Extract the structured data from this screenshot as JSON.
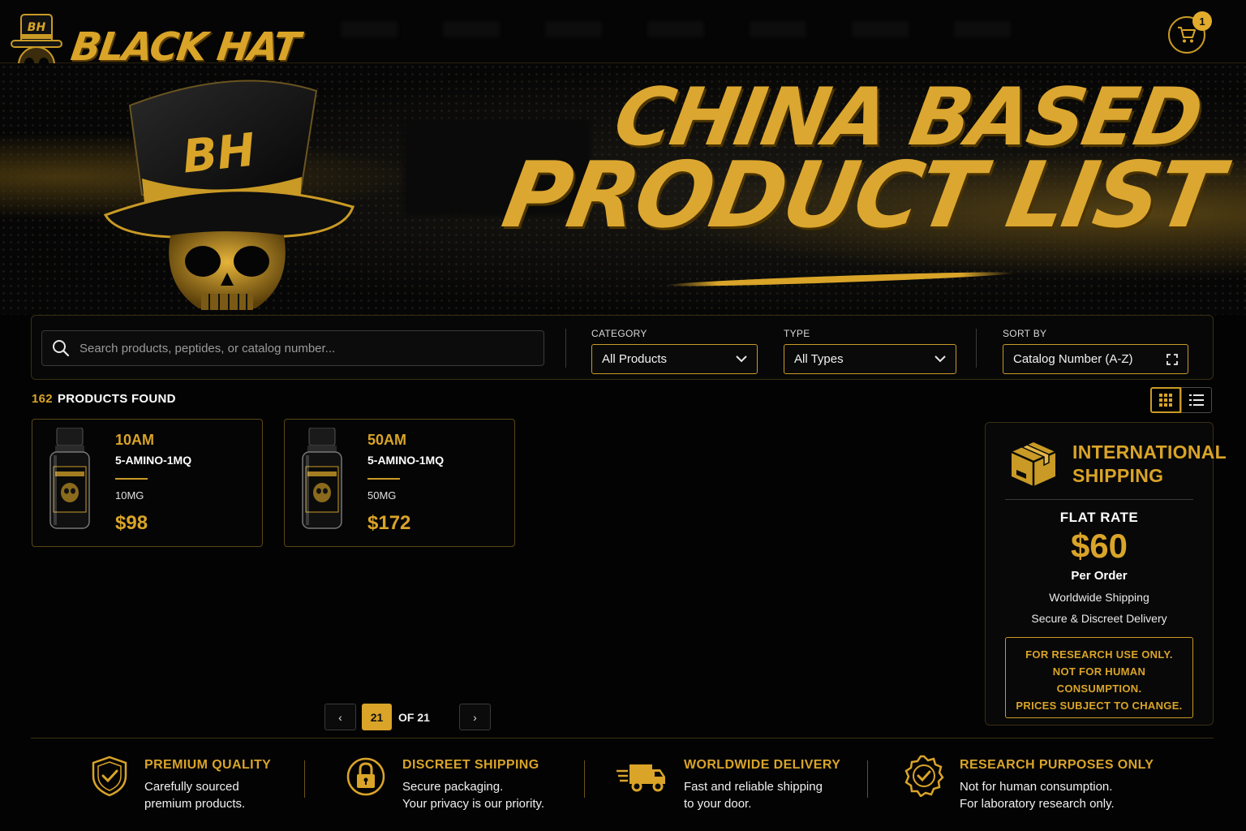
{
  "header": {
    "logo_text": "BLACK HAT",
    "logo_badge": "BH",
    "cart_count": "1"
  },
  "hero": {
    "title_line1": "CHINA BASED",
    "title_line2": "PRODUCT LIST",
    "hat_badge": "BH"
  },
  "filters": {
    "search_placeholder": "Search products, peptides, or catalog number...",
    "category_label": "CATEGORY",
    "category_value": "All Products",
    "type_label": "TYPE",
    "type_value": "All Types",
    "sort_label": "SORT BY",
    "sort_value": "Catalog Number (A-Z)"
  },
  "results": {
    "count": "162",
    "label": "PRODUCTS FOUND"
  },
  "products": [
    {
      "code": "10AM",
      "name": "5-AMINO-1MQ",
      "dose": "10MG",
      "price": "$98"
    },
    {
      "code": "50AM",
      "name": "5-AMINO-1MQ",
      "dose": "50MG",
      "price": "$172"
    }
  ],
  "shipping": {
    "title_line1": "INTERNATIONAL",
    "title_line2": "SHIPPING",
    "flat_rate": "FLAT RATE",
    "amount": "$60",
    "per": "Per Order",
    "line1": "Worldwide Shipping",
    "line2": "Secure & Discreet Delivery",
    "notice": [
      "FOR RESEARCH USE ONLY.",
      "NOT FOR HUMAN",
      "CONSUMPTION.",
      "PRICES SUBJECT TO CHANGE."
    ]
  },
  "pagination": {
    "prev": "‹",
    "current": "21",
    "of": "OF 21",
    "next": "›"
  },
  "features": [
    {
      "title": "PREMIUM QUALITY",
      "line1": "Carefully sourced",
      "line2": "premium products.",
      "icon": "shield-check-icon"
    },
    {
      "title": "DISCREET SHIPPING",
      "line1": "Secure packaging.",
      "line2": "Your privacy is our priority.",
      "icon": "lock-icon"
    },
    {
      "title": "WORLDWIDE DELIVERY",
      "line1": "Fast and reliable shipping",
      "line2": "to your door.",
      "icon": "truck-icon"
    },
    {
      "title": "RESEARCH PURPOSES ONLY",
      "line1": "Not for human consumption.",
      "line2": "For laboratory research only.",
      "icon": "badge-check-icon"
    }
  ],
  "colors": {
    "accent": "#d9a428",
    "background": "#030303"
  }
}
